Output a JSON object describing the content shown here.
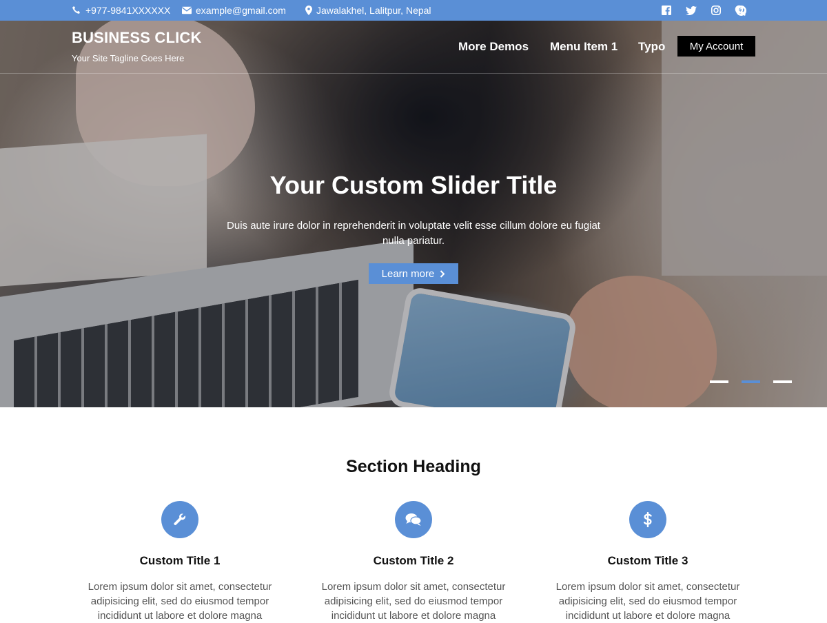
{
  "topbar": {
    "phone": "+977-9841XXXXXX",
    "email": "example@gmail.com",
    "address": "Jawalakhel, Lalitpur, Nepal",
    "social_icons": [
      "facebook-icon",
      "twitter-icon",
      "instagram-icon",
      "pinterest-icon"
    ],
    "search_icon": "search-icon"
  },
  "header": {
    "site_title": "BUSINESS CLICK",
    "tagline": "Your Site Tagline Goes Here",
    "nav": [
      {
        "label": "More Demos"
      },
      {
        "label": "Menu Item 1"
      },
      {
        "label": "Typo"
      }
    ],
    "account_label": "My Account"
  },
  "slider": {
    "title": "Your Custom Slider Title",
    "text": "Duis aute irure dolor in reprehenderit in voluptate velit esse cillum dolore eu fugiat nulla pariatur.",
    "button_label": "Learn more",
    "dot_count": 3,
    "active_dot": 2
  },
  "features": {
    "heading": "Section Heading",
    "items": [
      {
        "icon": "wrench-icon",
        "title": "Custom Title 1",
        "text": "Lorem ipsum dolor sit amet, consectetur adipisicing elit, sed do eiusmod tempor incididunt ut labore et dolore magna"
      },
      {
        "icon": "chat-bubbles-icon",
        "title": "Custom Title 2",
        "text": "Lorem ipsum dolor sit amet, consectetur adipisicing elit, sed do eiusmod tempor incididunt ut labore et dolore magna"
      },
      {
        "icon": "dollar-icon",
        "title": "Custom Title 3",
        "text": "Lorem ipsum dolor sit amet, consectetur adipisicing elit, sed do eiusmod tempor incididunt ut labore et dolore magna"
      }
    ]
  },
  "colors": {
    "accent": "#5a8fd6",
    "account_button": "#000000"
  }
}
